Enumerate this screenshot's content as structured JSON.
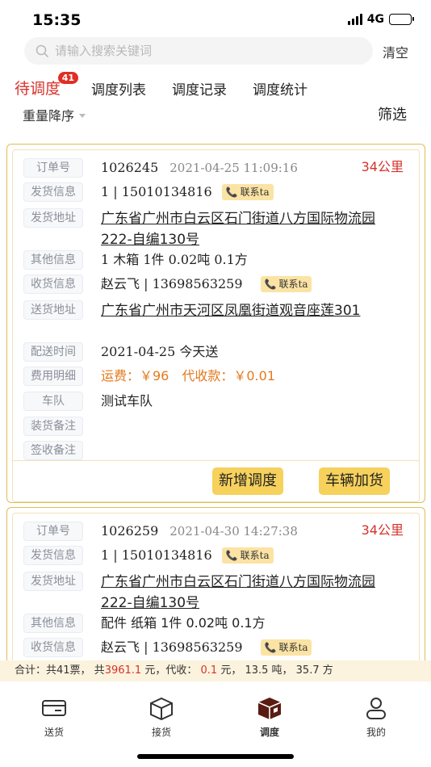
{
  "status": {
    "time": "15:35",
    "network": "4G"
  },
  "search": {
    "placeholder": "请输入搜索关键词",
    "clear_label": "清空"
  },
  "tabs": [
    {
      "label": "待调度",
      "badge": "41",
      "active": true
    },
    {
      "label": "调度列表"
    },
    {
      "label": "调度记录"
    },
    {
      "label": "调度统计"
    }
  ],
  "sort_label": "重量降序",
  "filter_label": "筛选",
  "field_labels": {
    "order_no": "订单号",
    "shipper": "发货信息",
    "pickup_address": "发货地址",
    "other": "其他信息",
    "receiver": "收货信息",
    "delivery_address": "送货地址",
    "delivery_time": "配送时间",
    "fees": "费用明细",
    "fleet": "车队",
    "load_note": "装货备注",
    "sign_note": "签收备注"
  },
  "contact_label": "联系ta",
  "orders": [
    {
      "order_no": "1026245",
      "timestamp": "2021-04-25 11:09:16",
      "distance": "34公里",
      "shipper": "1 | 15010134816",
      "pickup_address": "广东省广州市白云区石门街道八方国际物流园222-自编130号",
      "other": "1 木箱 1件 0.02吨 0.1方",
      "receiver": "赵云飞 | 13698563259",
      "delivery_address": "广东省广州市天河区凤凰街道观音座莲301",
      "delivery_time": "2021-04-25 今天送",
      "freight": "运费：￥96",
      "cod": "代收款：￥0.01",
      "fleet": "测试车队",
      "buttons": {
        "add_dispatch": "新增调度",
        "vehicle_load": "车辆加货"
      }
    },
    {
      "order_no": "1026259",
      "timestamp": "2021-04-30 14:27:38",
      "distance": "34公里",
      "shipper": "1 | 15010134816",
      "pickup_address": "广东省广州市白云区石门街道八方国际物流园222-自编130号",
      "other": "配件 纸箱 1件 0.02吨 0.1方",
      "receiver": "赵云飞 | 13698563259"
    }
  ],
  "totals": {
    "prefix": "合计：共41票，  共",
    "amount": "3961.1",
    "mid": "元，代收：",
    "cod": "0.1",
    "suffix": "元，    13.5 吨，    35.7 方"
  },
  "nav": [
    {
      "label": "送货",
      "icon": "truck-delivery-icon"
    },
    {
      "label": "接货",
      "icon": "package-receive-icon"
    },
    {
      "label": "调度",
      "icon": "dispatch-box-icon",
      "active": true
    },
    {
      "label": "我的",
      "icon": "user-profile-icon"
    }
  ],
  "colors": {
    "accent_red": "#d6322b",
    "card_border": "#e3bc55",
    "button_yellow": "#f6d15c",
    "fee_orange": "#e37a1d"
  }
}
